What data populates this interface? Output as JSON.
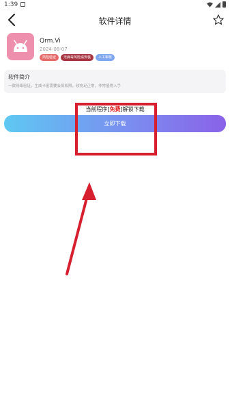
{
  "status_bar": {
    "time": "1:39",
    "icons": [
      "notification-icon",
      "wifi-icon",
      "signal-icon",
      "battery-icon"
    ]
  },
  "header": {
    "title": "软件详情",
    "back_icon": "chevron-left-icon",
    "favorite_icon": "star-outline-icon"
  },
  "app": {
    "name": "Qrm.Vi",
    "date": "2024-08-07",
    "icon": "android-icon",
    "icon_color": "#ef8fae",
    "tags": [
      {
        "label": "风险验证",
        "color": "#e56a6a"
      },
      {
        "label": "无病毒风险请安装",
        "color": "#a63540"
      },
      {
        "label": "人工审核",
        "color": "#7ea7f0"
      }
    ]
  },
  "intro": {
    "heading": "软件简介",
    "text": "一款网络验证，生成卡密需要会员权限，较充足正常，非常值得入手"
  },
  "notice": {
    "prefix": "当前程序[",
    "highlight": "免费",
    "suffix": "]解锁下载"
  },
  "download_button": {
    "label": "立即下载"
  },
  "colors": {
    "annotation": "#d62030",
    "button_gradient_start": "#5ec8f2",
    "button_gradient_end": "#8a62e8"
  }
}
